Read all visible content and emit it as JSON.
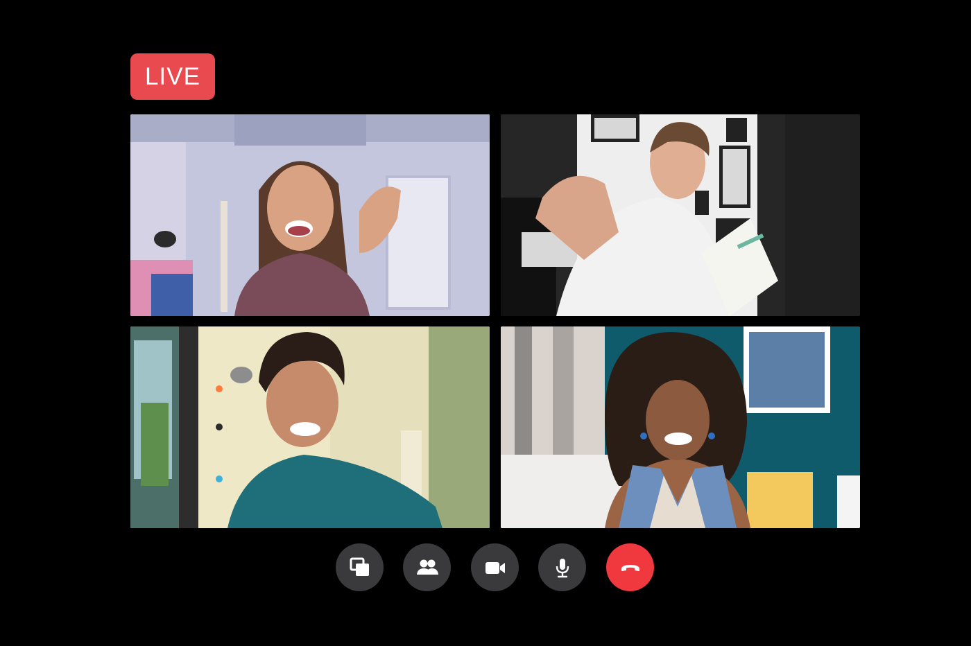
{
  "live_badge": {
    "label": "LIVE",
    "color": "#e84a4f"
  },
  "participants": [
    {
      "id": "participant-1",
      "description_colors": {
        "wall": "#c6c9de",
        "accent": "#e59bb6"
      }
    },
    {
      "id": "participant-2",
      "description_colors": {
        "wall": "#2a2a2a",
        "accent": "#ffffff"
      }
    },
    {
      "id": "participant-3",
      "description_colors": {
        "wall": "#e7e0bc",
        "accent": "#1f6d78"
      }
    },
    {
      "id": "participant-4",
      "description_colors": {
        "wall": "#0f5c6e",
        "accent": "#f3c85c"
      }
    }
  ],
  "controls": [
    {
      "name": "share-screen-button",
      "icon": "share-screen-icon"
    },
    {
      "name": "participants-button",
      "icon": "people-icon"
    },
    {
      "name": "camera-button",
      "icon": "video-camera-icon"
    },
    {
      "name": "microphone-button",
      "icon": "microphone-icon"
    },
    {
      "name": "end-call-button",
      "icon": "hang-up-icon",
      "color": "#f0383f"
    }
  ]
}
